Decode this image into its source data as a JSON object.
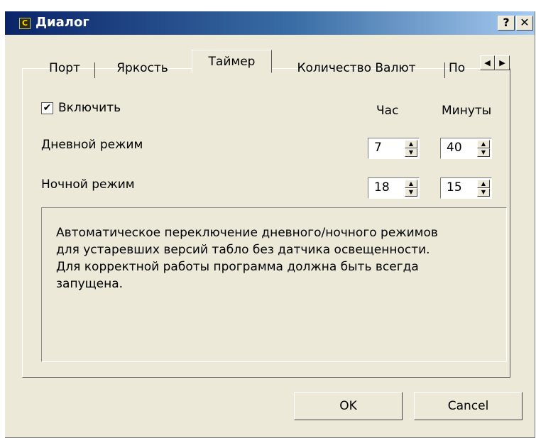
{
  "window": {
    "title": "Диалог",
    "help_button": "?",
    "close_button": "✕"
  },
  "tabs": [
    {
      "label": "Порт"
    },
    {
      "label": "Яркость"
    },
    {
      "label": "Таймер",
      "active": true
    },
    {
      "label": "Количество Валют"
    },
    {
      "label": "По"
    }
  ],
  "tab_scroll": {
    "left": "◀",
    "right": "▶"
  },
  "timer": {
    "enable_label": "Включить",
    "enable_checked": true,
    "checkmark": "✔",
    "hour_header": "Час",
    "minute_header": "Минуты",
    "day_mode": {
      "label": "Дневной режим",
      "hour": "7",
      "minute": "40"
    },
    "night_mode": {
      "label": "Ночной режим",
      "hour": "18",
      "minute": "15"
    },
    "description_lines": [
      "Автоматическое переключение дневного/ночного режимов",
      "для устаревших версий табло без датчика освещенности.",
      "Для корректной работы программа должна быть всегда",
      "запущена."
    ]
  },
  "buttons": {
    "ok": "OK",
    "cancel": "Cancel"
  },
  "spin_arrows": {
    "up": "▲",
    "down": "▼"
  },
  "colors": {
    "titlebar_start": "#0a246a",
    "titlebar_end": "#a6caf0",
    "face": "#ece9d8"
  }
}
